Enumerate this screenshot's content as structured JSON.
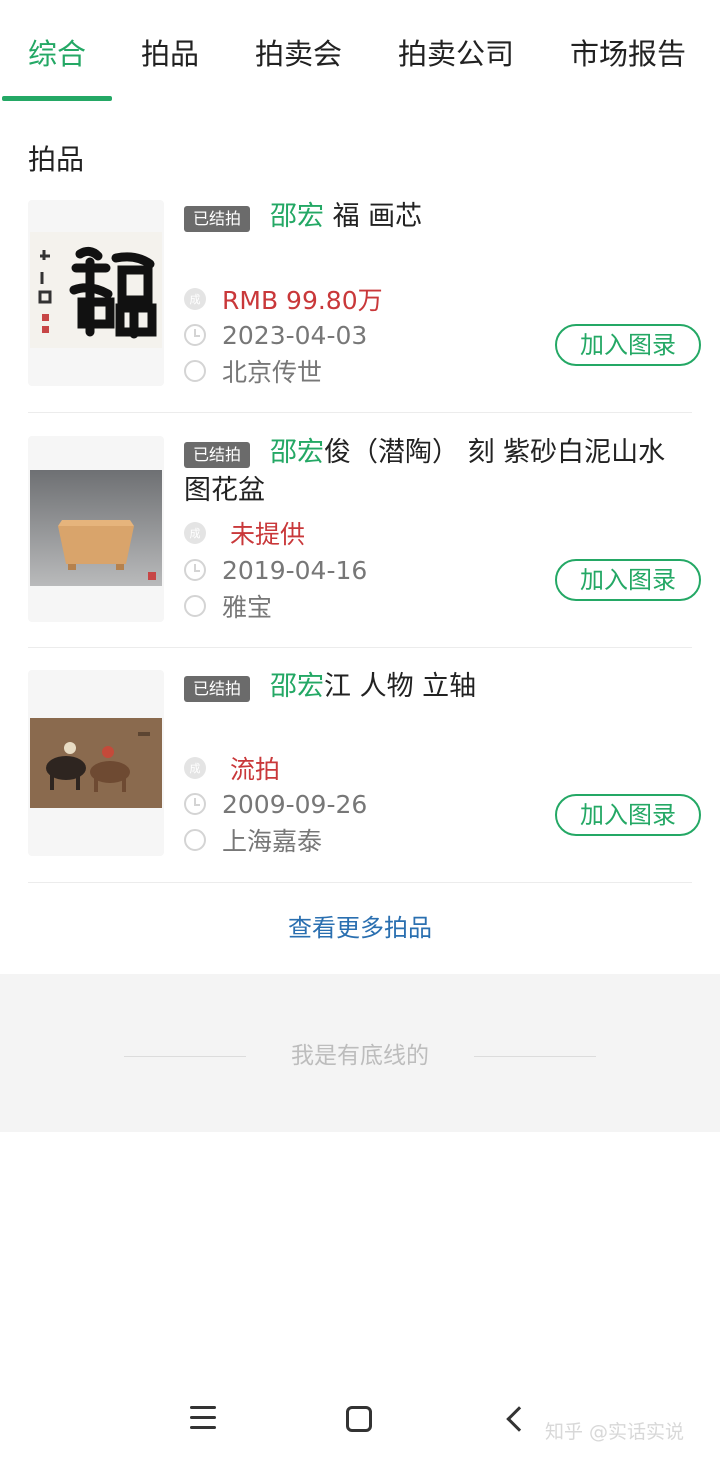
{
  "tabs": [
    {
      "label": "综合",
      "active": true
    },
    {
      "label": "拍品",
      "active": false
    },
    {
      "label": "拍卖会",
      "active": false
    },
    {
      "label": "拍卖公司",
      "active": false
    },
    {
      "label": "市场报告",
      "active": false
    }
  ],
  "section": {
    "title": "拍品"
  },
  "lots": [
    {
      "badge": "已结拍",
      "artist": "邵宏",
      "title_rest": " 福 画芯",
      "price": "RMB 99.80万",
      "date": "2023-04-03",
      "auction_house": "北京传世",
      "add_label": "加入图录",
      "deal_icon": "成"
    },
    {
      "badge": "已结拍",
      "artist": "邵宏",
      "title_rest": "俊（潜陶） 刻 紫砂白泥山水图花盆",
      "price": "未提供",
      "date": "2019-04-16",
      "auction_house": "雅宝",
      "add_label": "加入图录",
      "deal_icon": "成"
    },
    {
      "badge": "已结拍",
      "artist": "邵宏",
      "title_rest": "江 人物 立轴",
      "price": "流拍",
      "date": "2009-09-26",
      "auction_house": "上海嘉泰",
      "add_label": "加入图录",
      "deal_icon": "成"
    }
  ],
  "more_link": "查看更多拍品",
  "footer_text": "我是有底线的",
  "watermark": "知乎 @实话实说",
  "colors": {
    "accent": "#24a865",
    "price": "#c9383a",
    "link": "#2a6fb0"
  },
  "icons": {
    "deal": "deal-icon",
    "date": "clock-icon",
    "house": "location-icon"
  }
}
